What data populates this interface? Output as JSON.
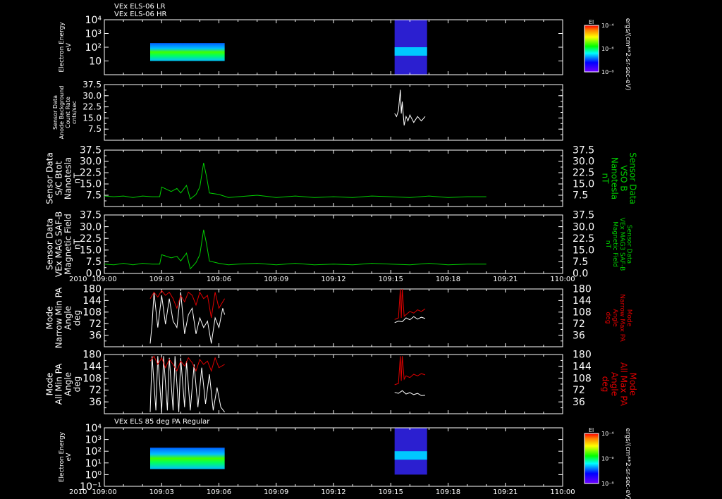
{
  "chart_data": [
    {
      "id": "p1",
      "type": "heatmap",
      "title_lines": [
        "VEx ELS-06 LR",
        "VEx ELS-06 HR"
      ],
      "ylabel_left": [
        "Electron Energy",
        "eV"
      ],
      "ylog": true,
      "ylim": [
        1,
        10000
      ],
      "yticks": [
        {
          "label": "10⁴",
          "value": 10000
        },
        {
          "label": "10³",
          "value": 1000
        },
        {
          "label": "10²",
          "value": 100
        },
        {
          "label": "10",
          "value": 10
        }
      ],
      "colorbar": {
        "label": "El",
        "units": "ergs/(cm**2-sr-sec-eV)",
        "ticks": [
          "10⁻⁴",
          "10⁻⁶",
          "10⁻⁸"
        ]
      },
      "blocks": [
        {
          "x0": 2.4,
          "x1": 6.3,
          "e0": 10,
          "e1": 200
        },
        {
          "x0": 15.2,
          "x1": 16.9,
          "e0": 1,
          "e1": 20000
        }
      ]
    },
    {
      "id": "p2",
      "type": "line",
      "ylabel_left": [
        "Sensor Data",
        "Anode Background",
        "Count Rate",
        "cnts/sec"
      ],
      "ylim": [
        0,
        37.5
      ],
      "yticks": [
        "37.5",
        "30.0",
        "22.5",
        "15.0",
        "7.5"
      ],
      "ytick_values": [
        37.5,
        30.0,
        22.5,
        15.0,
        7.5
      ],
      "series": [
        {
          "color": "#ffffff",
          "x": [
            15.2,
            15.3,
            15.4,
            15.5,
            15.55,
            15.6,
            15.7,
            15.8,
            15.9,
            16.0,
            16.2,
            16.4,
            16.6,
            16.8
          ],
          "y": [
            18,
            16,
            20,
            34,
            18,
            26,
            10,
            16,
            13,
            17,
            12,
            16,
            13,
            16
          ]
        }
      ]
    },
    {
      "id": "p3",
      "type": "line",
      "ylabel_left": [
        "Sensor Data",
        "S/C Btot",
        "Nanotesla",
        "nT"
      ],
      "ylabel_right": [
        "Sensor Data",
        "VSO B",
        "Nanotesla",
        "nT"
      ],
      "ylim": [
        0,
        37.5
      ],
      "yticks": [
        "37.5",
        "30.0",
        "22.5",
        "15.0",
        "7.5"
      ],
      "ytick_values": [
        37.5,
        30.0,
        22.5,
        15.0,
        7.5
      ],
      "series": [
        {
          "color": "#00d000",
          "x": [
            0,
            0.5,
            1,
            1.5,
            2,
            2.5,
            2.9,
            3.0,
            3.5,
            3.8,
            4.0,
            4.3,
            4.5,
            4.8,
            5.0,
            5.2,
            5.35,
            5.5,
            6.0,
            6.5,
            7,
            8,
            9,
            10,
            11,
            12,
            13,
            14,
            15,
            16,
            17,
            18,
            19,
            20
          ],
          "y": [
            7,
            6.5,
            7,
            6,
            7,
            6.5,
            6.5,
            13,
            10,
            12,
            9,
            14,
            5,
            8,
            13,
            29,
            20,
            9,
            8,
            6,
            6.5,
            7.5,
            6,
            7,
            6,
            6.5,
            6,
            7,
            6.5,
            6,
            7,
            6,
            6.5,
            6.5
          ]
        }
      ]
    },
    {
      "id": "p4",
      "type": "line",
      "ylabel_left": [
        "Sensor Data",
        "VEx MAG SAF-B",
        "Magnetic Field",
        "nT"
      ],
      "ylabel_right": [
        "Sensor Data",
        "VEx MAG3 SAF-B",
        "Magnetic Field",
        "nT"
      ],
      "ylim": [
        0,
        37.5
      ],
      "yticks": [
        "37.5",
        "30.0",
        "22.5",
        "15.0",
        "7.5",
        "0.0"
      ],
      "ytick_values": [
        37.5,
        30.0,
        22.5,
        15.0,
        7.5,
        0.0
      ],
      "series": [
        {
          "color": "#00d000",
          "x": [
            0,
            0.5,
            1,
            1.5,
            2,
            2.5,
            2.9,
            3.0,
            3.5,
            3.8,
            4.0,
            4.3,
            4.5,
            4.8,
            5.0,
            5.2,
            5.35,
            5.5,
            6.0,
            6.5,
            7,
            8,
            9,
            10,
            11,
            12,
            13,
            14,
            15,
            16,
            17,
            18,
            19,
            20
          ],
          "y": [
            6,
            5.5,
            6.5,
            5.5,
            6.5,
            6,
            6,
            12,
            10,
            11,
            8,
            13,
            3,
            7,
            12,
            28,
            19,
            8,
            6.5,
            5.5,
            6,
            6.5,
            5.5,
            6.5,
            5.5,
            6,
            5.5,
            6.5,
            6,
            5.5,
            6.5,
            5.5,
            6,
            6
          ]
        }
      ]
    },
    {
      "id": "p5",
      "type": "line",
      "ylabel_left": [
        "Mode",
        "Narrow Min PA",
        "Angle",
        "deg"
      ],
      "ylabel_right": [
        "Mode",
        "Narrow Max PA",
        "Angle",
        "deg"
      ],
      "ylim": [
        0,
        180
      ],
      "yticks": [
        "180",
        "144",
        "108",
        "72",
        "36"
      ],
      "ytick_values": [
        180,
        144,
        108,
        72,
        36
      ],
      "series": [
        {
          "color": "#ffffff",
          "x": [
            2.4,
            2.5,
            2.6,
            2.8,
            3.0,
            3.2,
            3.4,
            3.6,
            3.8,
            4.0,
            4.2,
            4.4,
            4.6,
            4.8,
            5.0,
            5.2,
            5.4,
            5.6,
            5.8,
            6.0,
            6.2,
            6.3
          ],
          "y": [
            10,
            70,
            170,
            60,
            160,
            70,
            150,
            80,
            60,
            170,
            40,
            100,
            120,
            40,
            90,
            60,
            80,
            10,
            90,
            60,
            120,
            100
          ]
        },
        {
          "color": "#ffffff",
          "x": [
            15.2,
            15.4,
            15.6,
            15.8,
            16.0,
            16.2,
            16.4,
            16.6,
            16.8
          ],
          "y": [
            75,
            80,
            78,
            90,
            84,
            94,
            86,
            92,
            88
          ]
        },
        {
          "color": "#e00000",
          "x": [
            2.4,
            2.6,
            2.8,
            3.0,
            3.2,
            3.4,
            3.6,
            3.8,
            4.0,
            4.2,
            4.4,
            4.6,
            4.8,
            5.0,
            5.2,
            5.4,
            5.6,
            5.8,
            6.0,
            6.2,
            6.3
          ],
          "y": [
            150,
            170,
            155,
            175,
            160,
            170,
            150,
            120,
            160,
            140,
            170,
            160,
            130,
            170,
            150,
            160,
            90,
            170,
            120,
            140,
            150
          ]
        },
        {
          "color": "#e00000",
          "x": [
            15.2,
            15.4,
            15.5,
            15.55,
            15.6,
            15.7,
            15.8,
            16.0,
            16.2,
            16.4,
            16.6,
            16.8
          ],
          "y": [
            85,
            90,
            180,
            90,
            180,
            95,
            100,
            110,
            105,
            115,
            110,
            118
          ]
        }
      ]
    },
    {
      "id": "p6",
      "type": "line",
      "ylabel_left": [
        "Mode",
        "All Min PA",
        "Angle",
        "deg"
      ],
      "ylabel_right": [
        "Mode",
        "All Max PA",
        "Angle",
        "deg"
      ],
      "ylim": [
        0,
        180
      ],
      "yticks": [
        "180",
        "144",
        "108",
        "72",
        "36"
      ],
      "ytick_values": [
        180,
        144,
        108,
        72,
        36
      ],
      "series": [
        {
          "color": "#ffffff",
          "x": [
            2.4,
            2.5,
            2.7,
            2.8,
            3.0,
            3.1,
            3.3,
            3.4,
            3.6,
            3.7,
            3.9,
            4.0,
            4.2,
            4.3,
            4.5,
            4.7,
            4.9,
            5.1,
            5.3,
            5.5,
            5.7,
            5.9,
            6.1,
            6.3
          ],
          "y": [
            5,
            175,
            10,
            175,
            5,
            175,
            10,
            170,
            10,
            175,
            5,
            170,
            20,
            160,
            10,
            150,
            20,
            140,
            30,
            120,
            10,
            80,
            20,
            5
          ]
        },
        {
          "color": "#ffffff",
          "x": [
            15.2,
            15.4,
            15.6,
            15.8,
            16.0,
            16.2,
            16.4,
            16.6,
            16.8
          ],
          "y": [
            65,
            62,
            70,
            60,
            64,
            58,
            62,
            55,
            56
          ]
        },
        {
          "color": "#e00000",
          "x": [
            2.4,
            2.6,
            2.8,
            3.0,
            3.2,
            3.4,
            3.6,
            3.8,
            4.0,
            4.2,
            4.4,
            4.6,
            4.8,
            5.0,
            5.2,
            5.4,
            5.6,
            5.8,
            6.0,
            6.3
          ],
          "y": [
            160,
            175,
            150,
            170,
            140,
            165,
            150,
            130,
            160,
            145,
            170,
            155,
            130,
            165,
            150,
            160,
            130,
            170,
            140,
            150
          ]
        },
        {
          "color": "#e00000",
          "x": [
            15.2,
            15.4,
            15.5,
            15.55,
            15.6,
            15.7,
            15.8,
            16.0,
            16.2,
            16.4,
            16.6,
            16.8
          ],
          "y": [
            88,
            92,
            175,
            100,
            175,
            105,
            115,
            110,
            120,
            115,
            122,
            118
          ]
        }
      ]
    },
    {
      "id": "p7",
      "type": "heatmap",
      "title_lines": [
        "VEx ELS 85 deg PA Regular"
      ],
      "ylabel_left": [
        "Electron Energy",
        "eV"
      ],
      "ylog": true,
      "ylim": [
        1,
        10000
      ],
      "yticks": [
        {
          "label": "10⁴",
          "value": 10000
        },
        {
          "label": "10³",
          "value": 1000
        },
        {
          "label": "10²",
          "value": 100
        },
        {
          "label": "10¹",
          "value": 10
        },
        {
          "label": "10⁰",
          "value": 1
        },
        {
          "label": "10⁻¹",
          "value": 0.1
        }
      ],
      "ylim_display": [
        0.1,
        10000
      ],
      "colorbar": {
        "label": "El",
        "units": "ergs/(cm**2-sr-sec-eV)",
        "ticks": [
          "10⁻⁴",
          "10⁻⁶",
          "10⁻⁸"
        ]
      },
      "blocks": [
        {
          "x0": 2.4,
          "x1": 6.3,
          "e0": 3,
          "e1": 200
        },
        {
          "x0": 15.2,
          "x1": 16.9,
          "e0": 1,
          "e1": 20000
        }
      ]
    }
  ],
  "x_axis": {
    "year_label": "2010",
    "tick_labels": [
      "109:00",
      "109:03",
      "109:06",
      "109:09",
      "109:12",
      "109:15",
      "109:18",
      "109:21",
      "110:00"
    ],
    "tick_values": [
      0,
      3,
      6,
      9,
      12,
      15,
      18,
      21,
      24
    ],
    "xlim": [
      0,
      24
    ]
  },
  "colors": {
    "background": "#000000",
    "axis": "#ffffff",
    "green_label": "#00d000",
    "red_label": "#e00000"
  }
}
